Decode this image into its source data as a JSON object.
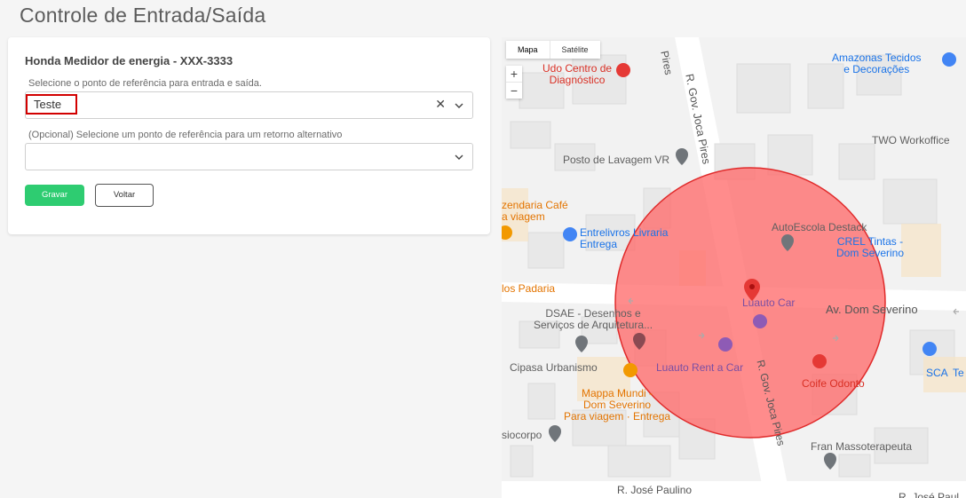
{
  "page": {
    "title": "Controle de Entrada/Saída"
  },
  "form": {
    "title": "Honda Medidor de energia - XXX-3333",
    "reference": {
      "label": "Selecione o ponto de referência para entrada e saída.",
      "value": "Teste",
      "clear_icon": "clear-icon",
      "dropdown_icon": "chevron-down-icon"
    },
    "alternative": {
      "label": "(Opcional) Selecione um ponto de referência para um retorno alternativo",
      "value": "",
      "dropdown_icon": "chevron-down-icon"
    },
    "save_label": "Gravar",
    "back_label": "Voltar",
    "colors": {
      "save": "#2ecc71",
      "highlight": "#d20000"
    }
  },
  "map": {
    "type_controls": {
      "map": "Mapa",
      "satellite": "Satélite"
    },
    "zoom_in": "+",
    "zoom_out": "−",
    "geofence_color": "#ff6b6b",
    "places": {
      "udo_1": "Udo Centro de",
      "udo_2": "Diagnóstico",
      "amazonas_1": "Amazonas Tecidos",
      "amazonas_2": "e Decorações",
      "two_workoffice": "TWO Workoffice",
      "posto": "Posto de Lavagem VR",
      "cafe": "zendaria Café",
      "cafe_sub": "a viagem",
      "entrelivros": "Entrelivros Livraria",
      "entrelivros_sub": "Entrega",
      "autoescola": "AutoEscola Destack",
      "crel_1": "CREL Tintas -",
      "crel_2": "Dom Severino",
      "padaria": "los Padaria",
      "luauto_car": "Luauto Car",
      "dsae_1": "DSAE - Desenhos e",
      "dsae_2": "Serviços de Arquitetura...",
      "cipasa": "Cipasa Urbanismo",
      "luauto_rent": "Luauto Rent a Car",
      "coife": "Coife Odonto",
      "sca": "SCA",
      "sca_suffix": "Te",
      "mappa_1": "Mappa Mundi -",
      "mappa_2": "Dom Severino",
      "mappa_sub": "Para viagem · Entrega",
      "siocorpo": "siocorpo",
      "fran": "Fran Massoterapeuta"
    },
    "streets": {
      "pires_top": "Pires",
      "gov_joca_top": "R. Gov. Joca Pires",
      "dom_severino": "Av. Dom Severino",
      "gov_joca_bottom": "R. Gov. Joca Pires",
      "jose_paulino": "R. José Paulino",
      "jose_paulino_right": "R. José Paul"
    },
    "icons": [
      "marker-icon",
      "hospital-icon",
      "shopping-icon",
      "car-icon",
      "cafe-icon",
      "restaurant-icon"
    ]
  }
}
